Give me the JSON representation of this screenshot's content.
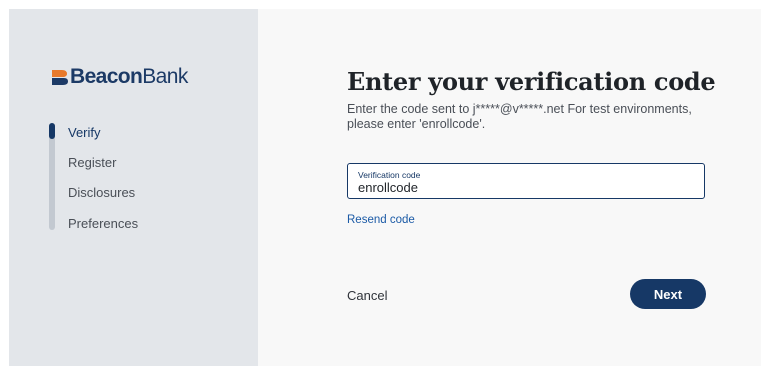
{
  "brand": {
    "name_part1": "Beacon",
    "name_part2": "Bank",
    "icon": "beacon-bank-logo-icon",
    "color": "#1c3a66"
  },
  "steps": [
    {
      "label": "Verify",
      "active": true
    },
    {
      "label": "Register",
      "active": false
    },
    {
      "label": "Disclosures",
      "active": false
    },
    {
      "label": "Preferences",
      "active": false
    }
  ],
  "main": {
    "title": "Enter your verification code",
    "subtitle": "Enter the code sent to j*****@v*****.net For test environments, please enter 'enrollcode'.",
    "field": {
      "label": "Verification code",
      "value": "enrollcode"
    },
    "resend_label": "Resend code",
    "cancel_label": "Cancel",
    "next_label": "Next"
  },
  "colors": {
    "primary": "#163866",
    "sidebar_bg": "#e3e6ea",
    "link": "#1b5aa6"
  }
}
